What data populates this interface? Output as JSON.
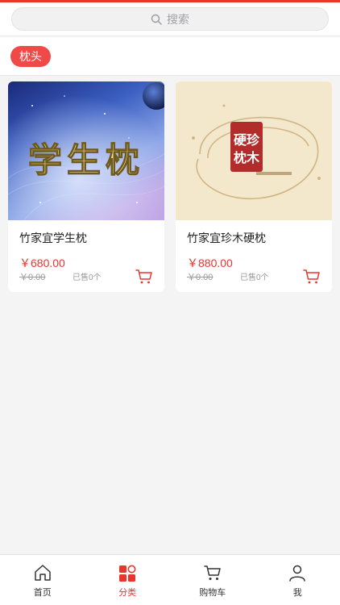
{
  "search": {
    "placeholder": "搜索"
  },
  "category": {
    "active_tag": "枕头"
  },
  "products": [
    {
      "name": "竹家宜学生枕",
      "price": "￥680.00",
      "original_price": "￥0.00",
      "sold": "已售0个",
      "image_text": "学生枕"
    },
    {
      "name": "竹家宜珍木硬枕",
      "price": "￥880.00",
      "original_price": "￥0.00",
      "sold": "已售0个",
      "image_text": "硬珍枕木"
    }
  ],
  "tabbar": {
    "items": [
      {
        "label": "首页",
        "icon": "home-icon"
      },
      {
        "label": "分类",
        "icon": "category-icon",
        "active": true
      },
      {
        "label": "购物车",
        "icon": "cart-icon"
      },
      {
        "label": "我",
        "icon": "user-icon"
      }
    ]
  },
  "colors": {
    "accent": "#e8352e",
    "tag": "#ef4a47",
    "background": "#f4f4f5"
  }
}
